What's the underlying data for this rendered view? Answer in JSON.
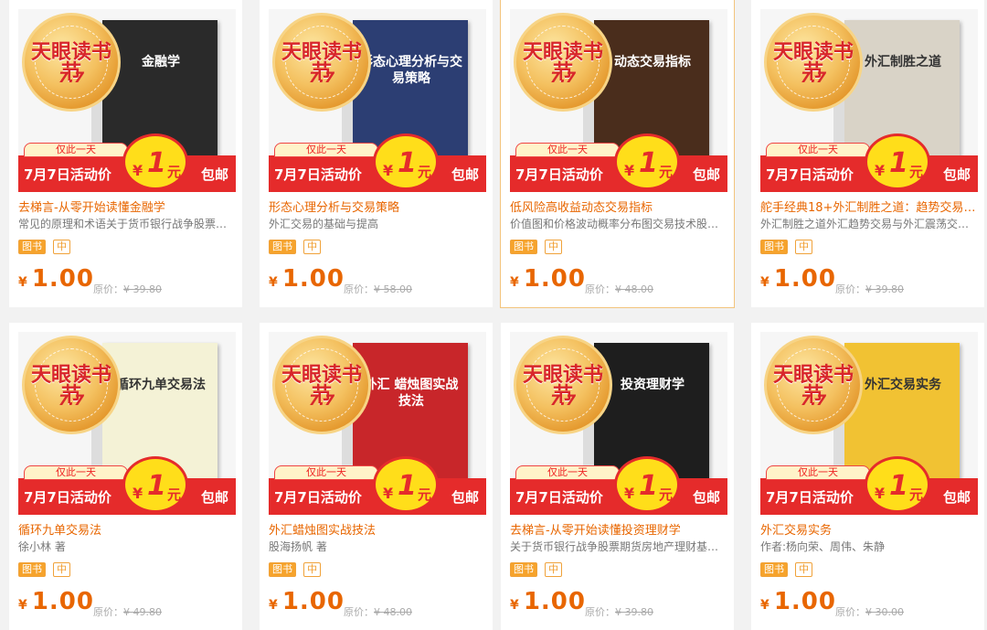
{
  "products": [
    {
      "cover_title": "金融学",
      "cover_color": "#2a2a2a",
      "cover_text_class": "dark",
      "medal": {
        "top": "天眼读书节",
        "edition": "7.7"
      },
      "banner": {
        "top": "仅此一天",
        "left": "7月7日活动价",
        "yen": "¥",
        "one": "1",
        "yuan": "元",
        "right": "包邮"
      },
      "title": "去梯言-从零开始读懂金融学",
      "subtitle": "常见的原理和术语关于货币银行战争股票…",
      "tags": [
        "图书",
        "中"
      ],
      "currency": "¥",
      "price": "1.00",
      "orig_label": "原价：",
      "orig_price": "¥ 39.80"
    },
    {
      "cover_title": "形态心理分析与交易策略",
      "cover_color": "#2c3e73",
      "cover_text_class": "dark",
      "medal": {
        "top": "天眼读书节",
        "edition": "7.7"
      },
      "banner": {
        "top": "仅此一天",
        "left": "7月7日活动价",
        "yen": "¥",
        "one": "1",
        "yuan": "元",
        "right": "包邮"
      },
      "title": "形态心理分析与交易策略",
      "subtitle": "外汇交易的基础与提高",
      "tags": [
        "图书",
        "中"
      ],
      "currency": "¥",
      "price": "1.00",
      "orig_label": "原价：",
      "orig_price": "¥ 58.00"
    },
    {
      "cover_title": "动态交易指标",
      "cover_color": "#4a2d1c",
      "cover_text_class": "dark",
      "medal": {
        "top": "天眼读书节",
        "edition": "7.7"
      },
      "banner": {
        "top": "仅此一天",
        "left": "7月7日活动价",
        "yen": "¥",
        "one": "1",
        "yuan": "元",
        "right": "包邮"
      },
      "title": "低风险高收益动态交易指标",
      "subtitle": "价值图和价格波动概率分布图交易技术股…",
      "tags": [
        "图书",
        "中"
      ],
      "currency": "¥",
      "price": "1.00",
      "orig_label": "原价：",
      "orig_price": "¥ 48.00"
    },
    {
      "cover_title": "外汇制胜之道",
      "cover_color": "#d9d3c7",
      "cover_text_class": "light",
      "medal": {
        "top": "天眼读书节",
        "edition": "7.7"
      },
      "banner": {
        "top": "仅此一天",
        "left": "7月7日活动价",
        "yen": "¥",
        "one": "1",
        "yuan": "元",
        "right": "包邮"
      },
      "title": "舵手经典18+外汇制胜之道：趋势交易与…",
      "subtitle": "外汇制胜之道外汇趋势交易与外汇震荡交…",
      "tags": [
        "图书",
        "中"
      ],
      "currency": "¥",
      "price": "1.00",
      "orig_label": "原价：",
      "orig_price": "¥ 39.80"
    },
    {
      "cover_title": "循环九单交易法",
      "cover_color": "#f4f2d6",
      "cover_text_class": "light",
      "medal": {
        "top": "天眼读书节",
        "edition": "7.7"
      },
      "banner": {
        "top": "仅此一天",
        "left": "7月7日活动价",
        "yen": "¥",
        "one": "1",
        "yuan": "元",
        "right": "包邮"
      },
      "title": "循环九单交易法",
      "subtitle": "徐小林 著",
      "tags": [
        "图书",
        "中"
      ],
      "currency": "¥",
      "price": "1.00",
      "orig_label": "原价：",
      "orig_price": "¥ 49.80"
    },
    {
      "cover_title": "外汇 蜡烛图实战技法",
      "cover_color": "#c8262a",
      "cover_text_class": "dark",
      "medal": {
        "top": "天眼读书节",
        "edition": "7.7"
      },
      "banner": {
        "top": "仅此一天",
        "left": "7月7日活动价",
        "yen": "¥",
        "one": "1",
        "yuan": "元",
        "right": "包邮"
      },
      "title": "外汇蜡烛图实战技法",
      "subtitle": "股海扬帆 著",
      "tags": [
        "图书",
        "中"
      ],
      "currency": "¥",
      "price": "1.00",
      "orig_label": "原价：",
      "orig_price": "¥ 48.00"
    },
    {
      "cover_title": "投资理财学",
      "cover_color": "#1e1e1e",
      "cover_text_class": "dark",
      "medal": {
        "top": "天眼读书节",
        "edition": "7.7"
      },
      "banner": {
        "top": "仅此一天",
        "left": "7月7日活动价",
        "yen": "¥",
        "one": "1",
        "yuan": "元",
        "right": "包邮"
      },
      "title": "去梯言-从零开始读懂投资理财学",
      "subtitle": "关于货币银行战争股票期货房地产理财基…",
      "tags": [
        "图书",
        "中"
      ],
      "currency": "¥",
      "price": "1.00",
      "orig_label": "原价：",
      "orig_price": "¥ 39.80"
    },
    {
      "cover_title": "外汇交易实务",
      "cover_color": "#f1c233",
      "cover_text_class": "light",
      "medal": {
        "top": "天眼读书节",
        "edition": "7.7"
      },
      "banner": {
        "top": "仅此一天",
        "left": "7月7日活动价",
        "yen": "¥",
        "one": "1",
        "yuan": "元",
        "right": "包邮"
      },
      "title": "外汇交易实务",
      "subtitle": "作者:杨向荣、周伟、朱静",
      "tags": [
        "图书",
        "中"
      ],
      "currency": "¥",
      "price": "1.00",
      "orig_label": "原价：",
      "orig_price": "¥ 30.00"
    }
  ]
}
